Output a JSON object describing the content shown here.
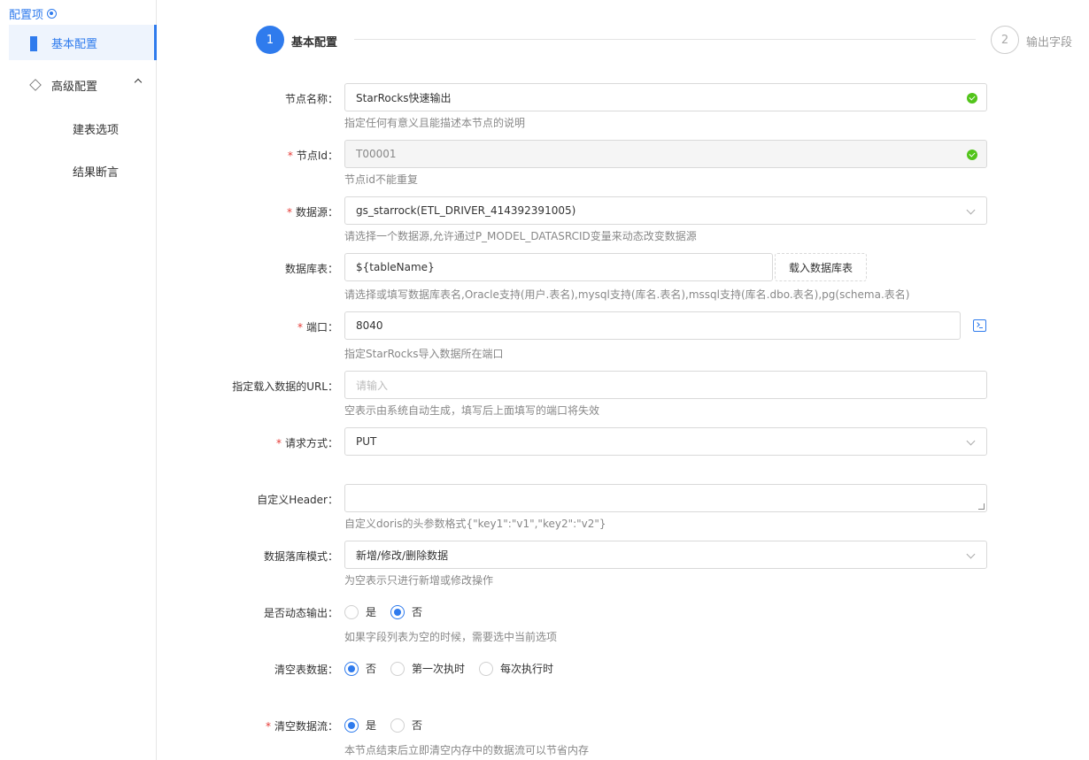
{
  "sidebar": {
    "title": "配置项",
    "items": [
      {
        "label": "基本配置"
      },
      {
        "label": "高级配置"
      },
      {
        "label": "建表选项"
      },
      {
        "label": "结果断言"
      }
    ]
  },
  "steps": [
    {
      "number": "1",
      "label": "基本配置"
    },
    {
      "number": "2",
      "label": "输出字段"
    }
  ],
  "form": {
    "node_name": {
      "label": "节点名称：",
      "value": "StarRocks快速输出",
      "help": "指定任何有意义且能描述本节点的说明"
    },
    "node_id": {
      "label": "节点Id：",
      "value": "T00001",
      "help": "节点id不能重复"
    },
    "datasource": {
      "label": "数据源：",
      "value": "gs_starrock(ETL_DRIVER_414392391005)",
      "help": "请选择一个数据源,允许通过P_MODEL_DATASRCID变量来动态改变数据源"
    },
    "db_table": {
      "label": "数据库表：",
      "value": "${tableName}",
      "button": "载入数据库表",
      "help": "请选择或填写数据库表名,Oracle支持(用户.表名),mysql支持(库名.表名),mssql支持(库名.dbo.表名),pg(schema.表名)"
    },
    "port": {
      "label": "端口：",
      "value": "8040",
      "help": "指定StarRocks导入数据所在端口"
    },
    "load_url": {
      "label": "指定载入数据的URL：",
      "placeholder": "请输入",
      "help": "空表示由系统自动生成，填写后上面填写的端口将失效"
    },
    "method": {
      "label": "请求方式：",
      "value": "PUT"
    },
    "header": {
      "label": "自定义Header：",
      "help": "自定义doris的头参数格式{\"key1\":\"v1\",\"key2\":\"v2\"}"
    },
    "mode": {
      "label": "数据落库模式：",
      "value": "新增/修改/删除数据",
      "help": "为空表示只进行新增或修改操作"
    },
    "dynamic": {
      "label": "是否动态输出：",
      "options": [
        "是",
        "否"
      ],
      "selected": "否",
      "help": "如果字段列表为空的时候，需要选中当前选项"
    },
    "clear_table": {
      "label": "清空表数据：",
      "options": [
        "否",
        "第一次执时",
        "每次执行时"
      ],
      "selected": "否"
    },
    "clear_stream": {
      "label": "清空数据流：",
      "options": [
        "是",
        "否"
      ],
      "selected": "是",
      "help": "本节点结束后立即清空内存中的数据流可以节省内存"
    }
  }
}
